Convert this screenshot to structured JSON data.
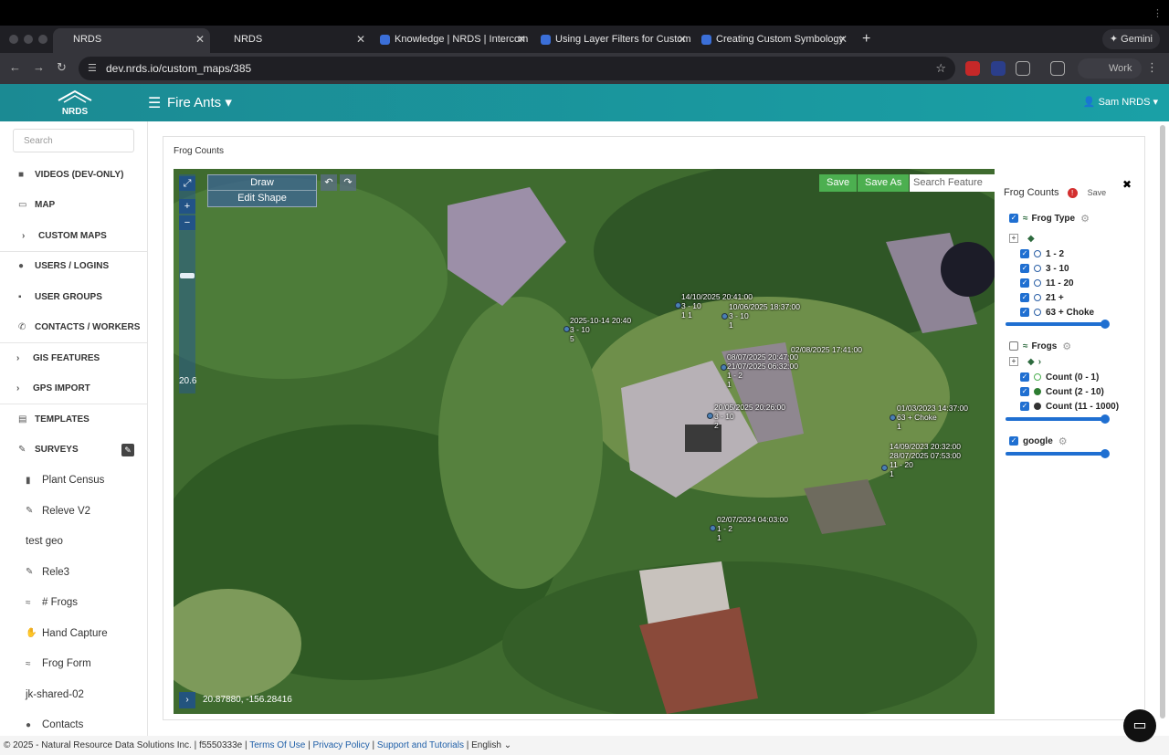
{
  "browser": {
    "tabs": [
      {
        "title": "NRDS",
        "active": true
      },
      {
        "title": "NRDS",
        "active": false
      },
      {
        "title": "Knowledge | NRDS | Intercom",
        "active": false
      },
      {
        "title": "Using Layer Filters for Custom",
        "active": false
      },
      {
        "title": "Creating Custom Symbology",
        "active": false
      }
    ],
    "gemini_label": "Gemini",
    "url": "dev.nrds.io/custom_maps/385",
    "profile_label": "Work"
  },
  "app": {
    "logo_text": "NRDS",
    "project_title": "Fire Ants",
    "user_name": "Sam NRDS"
  },
  "sidebar": {
    "search_placeholder": "Search",
    "items": [
      {
        "label": "VIDEOS (DEV-ONLY)",
        "icon": "video-icon"
      },
      {
        "label": "MAP",
        "icon": "map-icon"
      },
      {
        "label": "CUSTOM MAPS",
        "icon": "chevron-right-icon"
      },
      {
        "label": "USERS / LOGINS",
        "icon": "users-icon"
      },
      {
        "label": "USER GROUPS",
        "icon": "group-icon"
      },
      {
        "label": "CONTACTS / WORKERS",
        "icon": "phone-icon"
      },
      {
        "label": "GIS FEATURES",
        "icon": "chevron-right-icon"
      },
      {
        "label": "GPS IMPORT",
        "icon": "chevron-right-icon"
      },
      {
        "label": "TEMPLATES",
        "icon": "document-icon"
      },
      {
        "label": "SURVEYS",
        "icon": "pen-icon"
      }
    ],
    "surveys": [
      "Plant Census",
      "Releve V2",
      "test geo",
      "Rele3",
      "# Frogs",
      "Hand Capture",
      "Frog Form",
      "jk-shared-02",
      "Contacts"
    ]
  },
  "main": {
    "title": "Frog Counts",
    "draw_label": "Draw",
    "edit_shape_label": "Edit Shape",
    "save_label": "Save",
    "save_as_label": "Save As",
    "search_feature_placeholder": "Search Feature",
    "zoom_level": "20.6",
    "coordinates": "20.87880, -156.28416",
    "markers": [
      {
        "label": "2025-10-14 20:40\n3 - 10\n5"
      },
      {
        "label": "14/10/2025 20:41:00\n3 - 10\n1 1"
      },
      {
        "label": "10/06/2025 18:37:00\n3 - 10\n1"
      },
      {
        "label": "08/07/2025 20:47:00\n21/07/2025 06:32:00\n1 - 2\n1"
      },
      {
        "label": "02/08/2025 17:41:00"
      },
      {
        "label": "20/05/2025 20:26:00\n3 - 10\n2"
      },
      {
        "label": "01/03/2023 14:37:00\n63 + Choke\n1"
      },
      {
        "label": "14/09/2023 20:32:00\n28/07/2025 07:53:00\n11 - 20\n1"
      },
      {
        "label": "02/07/2024 04:03:00\n1 - 2\n1"
      }
    ]
  },
  "layers": {
    "title": "Frog Counts",
    "save_label": "Save",
    "groups": [
      {
        "name": "Frog Type",
        "checked": true,
        "items": [
          "1 - 2",
          "3 - 10",
          "11 - 20",
          "21 +",
          "63 + Choke"
        ]
      },
      {
        "name": "Frogs",
        "checked": false,
        "items": [
          "Count (0 - 1)",
          "Count (2 - 10)",
          "Count (11 - 1000)"
        ]
      },
      {
        "name": "google",
        "checked": true,
        "items": []
      }
    ],
    "colors": {
      "checkbox": "#1f6fd1",
      "count_low": "#4caf50",
      "count_mid": "#2e7d32",
      "count_high": "#333333"
    }
  },
  "footer": {
    "copyright": "© 2025 - Natural Resource Data Solutions Inc. | f5550333e |",
    "links": [
      "Terms Of Use",
      "Privacy Policy",
      "Support and Tutorials"
    ],
    "language": "English"
  }
}
